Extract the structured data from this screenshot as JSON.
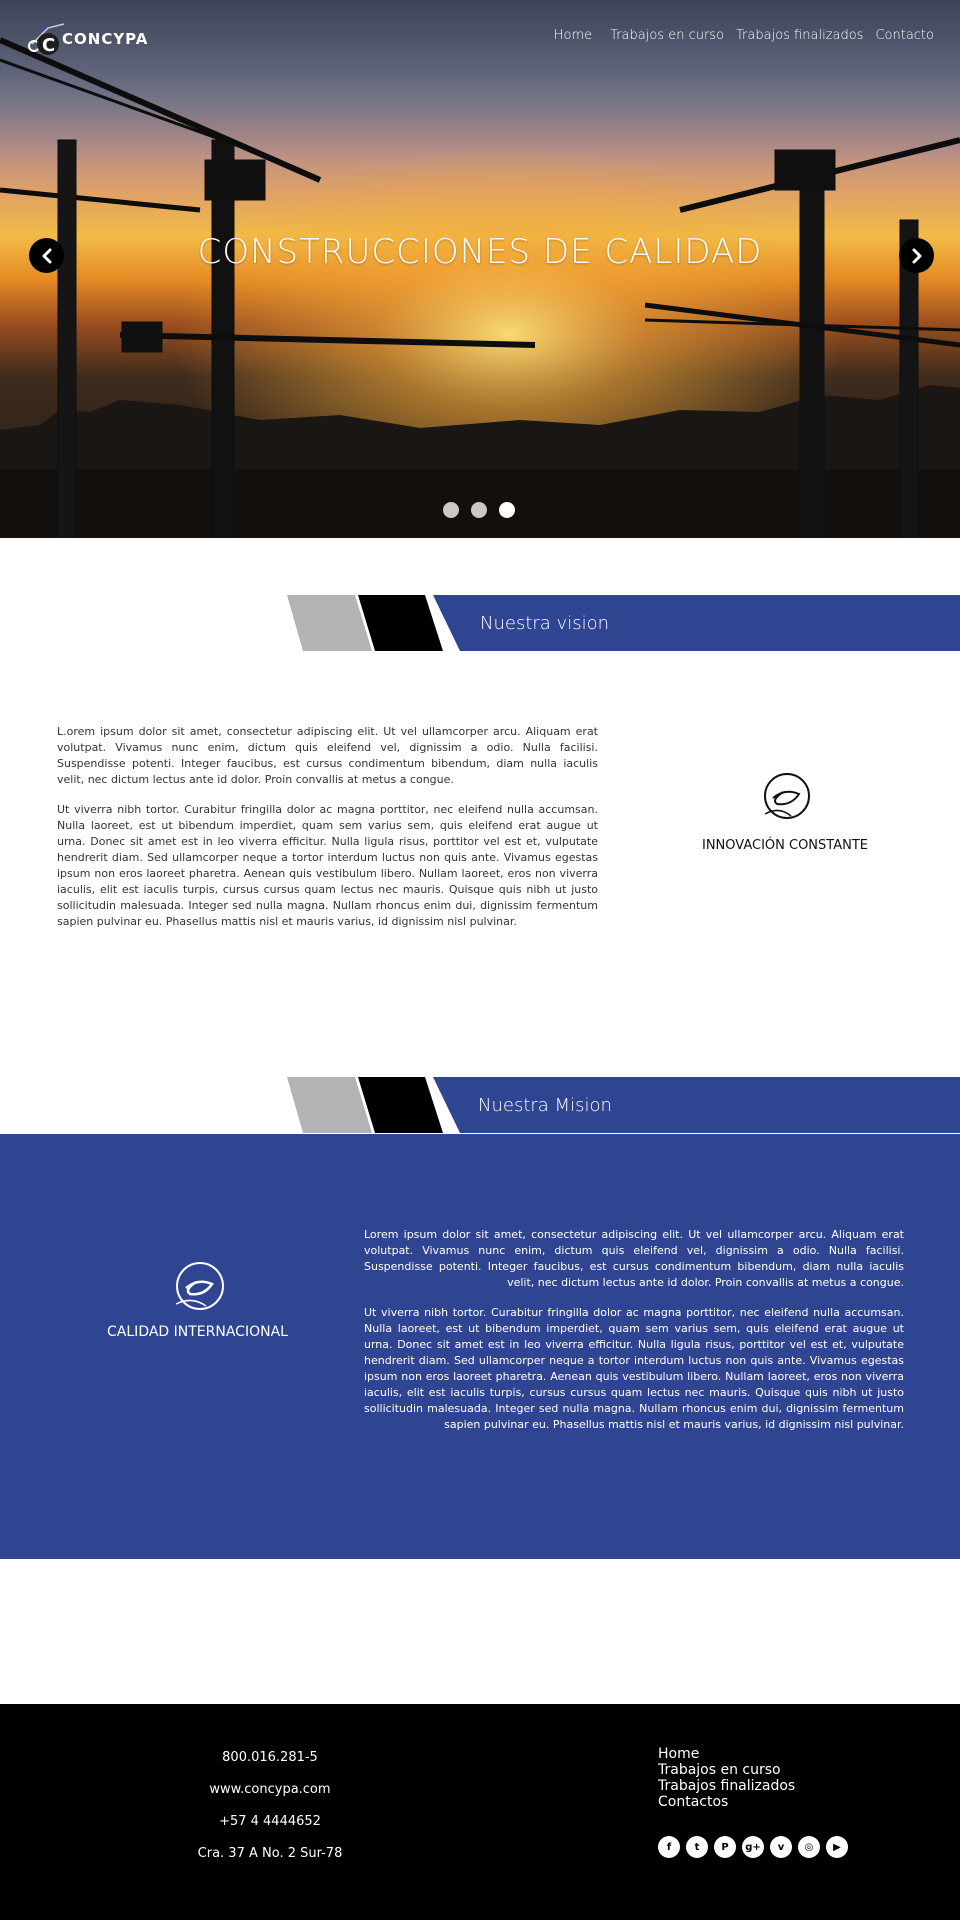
{
  "brand": {
    "name": "CONCYPA"
  },
  "nav": {
    "items": [
      "Home",
      "Trabajos en curso",
      "Trabajos finalizados",
      "Contacto"
    ]
  },
  "hero": {
    "title": "CONSTRUCCIONES DE CALIDAD",
    "slides_total": 3,
    "active_slide": 3
  },
  "vision": {
    "title": "Nuestra vision",
    "paragraphs": [
      "L.orem ipsum dolor sit amet, consectetur adipiscing elit. Ut vel ullamcorper arcu. Aliquam erat volutpat. Vivamus nunc enim, dictum quis eleifend vel, dignissim a odio. Nulla facilisi. Suspendisse potenti. Integer faucibus, est cursus condimentum bibendum, diam nulla iaculis velit, nec dictum lectus ante id dolor. Proin convallis at metus a congue.",
      "Ut viverra nibh tortor. Curabitur fringilla dolor ac magna porttitor, nec eleifend nulla accumsan. Nulla laoreet, est ut bibendum imperdiet, quam sem varius sem, quis eleifend erat augue ut urna. Donec sit amet est in leo viverra efficitur. Nulla ligula risus, porttitor vel est et, vulputate hendrerit diam. Sed ullamcorper neque a tortor interdum luctus non quis ante. Vivamus egestas ipsum non eros laoreet pharetra. Aenean quis vestibulum libero. Nullam laoreet, eros non viverra iaculis, elit est iaculis turpis, cursus cursus quam lectus nec mauris. Quisque quis nibh ut justo sollicitudin malesuada. Integer sed nulla magna. Nullam rhoncus enim dui, dignissim fermentum sapien pulvinar eu. Phasellus mattis nisl et mauris varius, id dignissim nisl pulvinar."
    ],
    "side_caption": "INNOVACIÓN CONSTANTE"
  },
  "mission": {
    "title": "Nuestra Mision",
    "paragraphs": [
      "Lorem ipsum dolor sit amet, consectetur adipiscing elit. Ut vel ullamcorper arcu. Aliquam erat volutpat. Vivamus nunc enim, dictum quis eleifend vel, dignissim a odio. Nulla facilisi. Suspendisse potenti. Integer faucibus, est cursus condimentum bibendum, diam nulla iaculis velit, nec dictum lectus ante id dolor. Proin convallis at metus a congue.",
      "Ut viverra nibh tortor. Curabitur fringilla dolor ac magna porttitor, nec eleifend nulla accumsan. Nulla laoreet, est ut bibendum imperdiet, quam sem varius sem, quis eleifend erat augue ut urna. Donec sit amet est in leo viverra efficitur. Nulla ligula risus, porttitor vel est et, vulputate hendrerit diam. Sed ullamcorper neque a tortor interdum luctus non quis ante. Vivamus egestas ipsum non eros laoreet pharetra. Aenean quis vestibulum libero. Nullam laoreet, eros non viverra iaculis, elit est iaculis turpis, cursus cursus quam lectus nec mauris. Quisque quis nibh ut justo sollicitudin malesuada. Integer sed nulla magna. Nullam rhoncus enim dui, dignissim fermentum sapien pulvinar eu. Phasellus mattis nisl et mauris varius, id dignissim nisl pulvinar."
    ],
    "side_caption": "CALIDAD INTERNACIONAL"
  },
  "footer": {
    "contact": [
      "800.016.281-5",
      "www.concypa.com",
      "+57 4 4444652",
      "Cra. 37 A No. 2 Sur-78"
    ],
    "links": [
      "Home",
      "Trabajos en curso",
      "Trabajos finalizados",
      "Contactos"
    ],
    "socials": [
      {
        "icon": "facebook-icon",
        "glyph": "f"
      },
      {
        "icon": "twitter-icon",
        "glyph": "t"
      },
      {
        "icon": "pinterest-icon",
        "glyph": "P"
      },
      {
        "icon": "google-plus-icon",
        "glyph": "g+"
      },
      {
        "icon": "vimeo-icon",
        "glyph": "v"
      },
      {
        "icon": "instagram-icon",
        "glyph": "◎"
      },
      {
        "icon": "youtube-icon",
        "glyph": "▶"
      }
    ]
  },
  "colors": {
    "brand_blue": "#304591",
    "footer_bg": "#000000",
    "accent_gray": "#b3b3b3"
  }
}
